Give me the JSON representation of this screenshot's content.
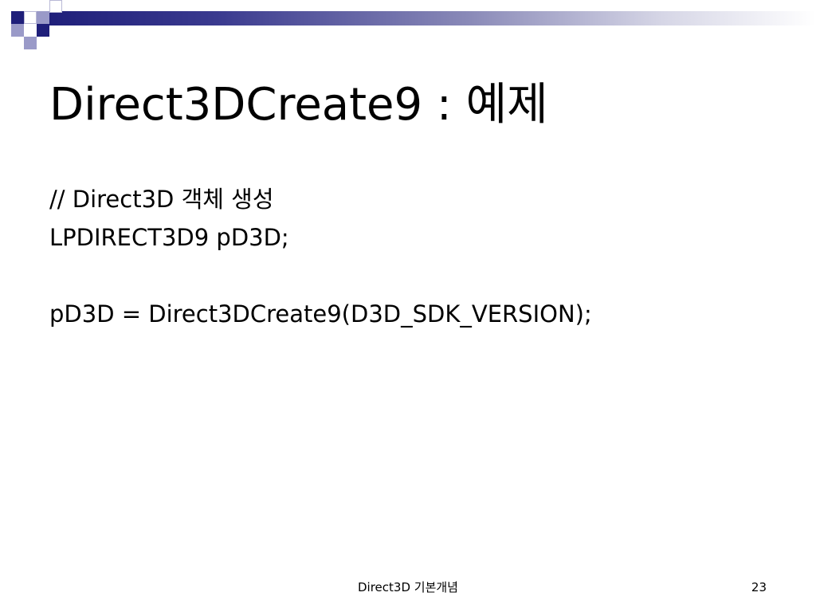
{
  "slide": {
    "title": "Direct3DCreate9 : 예제",
    "body_lines": [
      "// Direct3D 객체 생성",
      "LPDIRECT3D9 pD3D;",
      "",
      "pD3D = Direct3DCreate9(D3D_SDK_VERSION);"
    ],
    "footer": {
      "center_text": "Direct3D 기본개념",
      "page_number": "23"
    }
  },
  "colors": {
    "accent_dark": "#1f1f7a",
    "accent_light": "#9a9ac8"
  }
}
